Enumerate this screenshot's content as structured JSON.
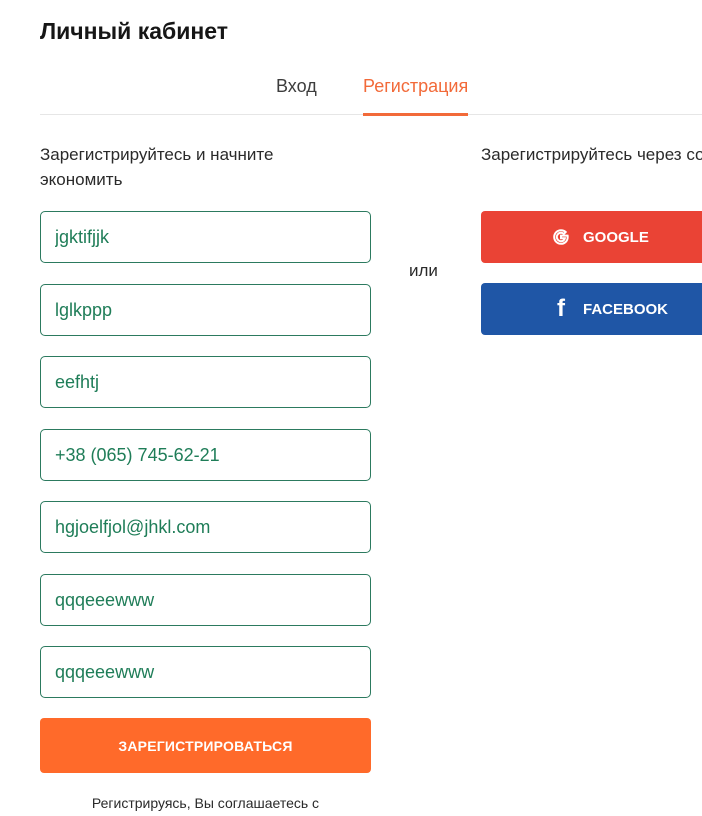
{
  "page": {
    "title": "Личный кабинет"
  },
  "tabs": {
    "login": "Вход",
    "register": "Регистрация",
    "active": "register"
  },
  "form": {
    "heading": "Зарегистрируйтесь и начните экономить",
    "fields": [
      {
        "name": "first-name-field",
        "value": "jgktifjjk"
      },
      {
        "name": "last-name-field",
        "value": "lglkppp"
      },
      {
        "name": "middle-name-field",
        "value": "eefhtj"
      },
      {
        "name": "phone-field",
        "value": "+38 (065) 745-62-21"
      },
      {
        "name": "email-field",
        "value": "hgjoelfjol@jhkl.com"
      },
      {
        "name": "password-field",
        "value": "qqqeeewww"
      },
      {
        "name": "password-confirm-field",
        "value": "qqqeeewww"
      }
    ],
    "submit_label": "ЗАРЕГИСТРИРОВАТЬСЯ",
    "agree_text": "Регистрируясь, Вы соглашаетесь с"
  },
  "divider": {
    "or_label": "или"
  },
  "social": {
    "heading": "Зарегистрируйтесь через социальную сеть",
    "google_label": "GOOGLE",
    "google_icon": "google-g-icon",
    "facebook_label": "FACEBOOK",
    "facebook_icon": "facebook-f-icon",
    "google_color": "#ea4335",
    "facebook_color": "#1f56a6"
  },
  "colors": {
    "accent": "#f26a39",
    "submit": "#ff6a2a",
    "field_border": "#2c7a5f",
    "field_text": "#1f7d58"
  }
}
